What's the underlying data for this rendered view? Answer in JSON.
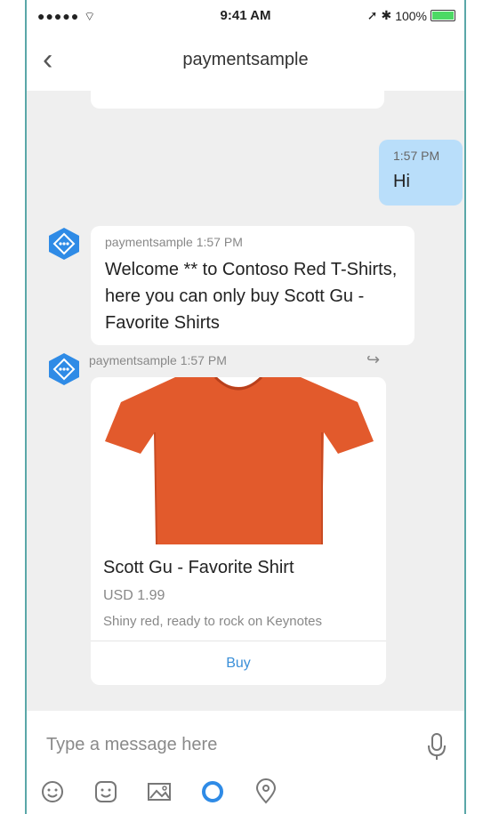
{
  "status_bar": {
    "signal": "●●●●● ",
    "wifi_icon": "wifi-icon",
    "time": "9:41 AM",
    "battery_text": "100%"
  },
  "header": {
    "back_icon": "chevron-left-icon",
    "title": "paymentsample"
  },
  "messages": {
    "user": {
      "time": "1:57 PM",
      "text": "Hi"
    },
    "bot_text": {
      "meta": "paymentsample 1:57 PM",
      "text": "Welcome ** to Contoso Red T-Shirts, here you can only buy Scott Gu - Favorite Shirts"
    },
    "bot_card": {
      "meta": "paymentsample 1:57 PM",
      "product_name": "Scott Gu - Favorite Shirt",
      "price": "USD 1.99",
      "description": "Shiny red, ready to rock on Keynotes",
      "action_label": "Buy",
      "product_color": "#e25a2c"
    }
  },
  "composer": {
    "placeholder": "Type a message here",
    "toolbar_icons": [
      "emoji-icon",
      "sticker-icon",
      "image-icon",
      "cortana-icon",
      "location-icon"
    ]
  },
  "colors": {
    "accent": "#3a8fd8",
    "user_bubble": "#b9defa",
    "chat_background": "#efefef"
  }
}
